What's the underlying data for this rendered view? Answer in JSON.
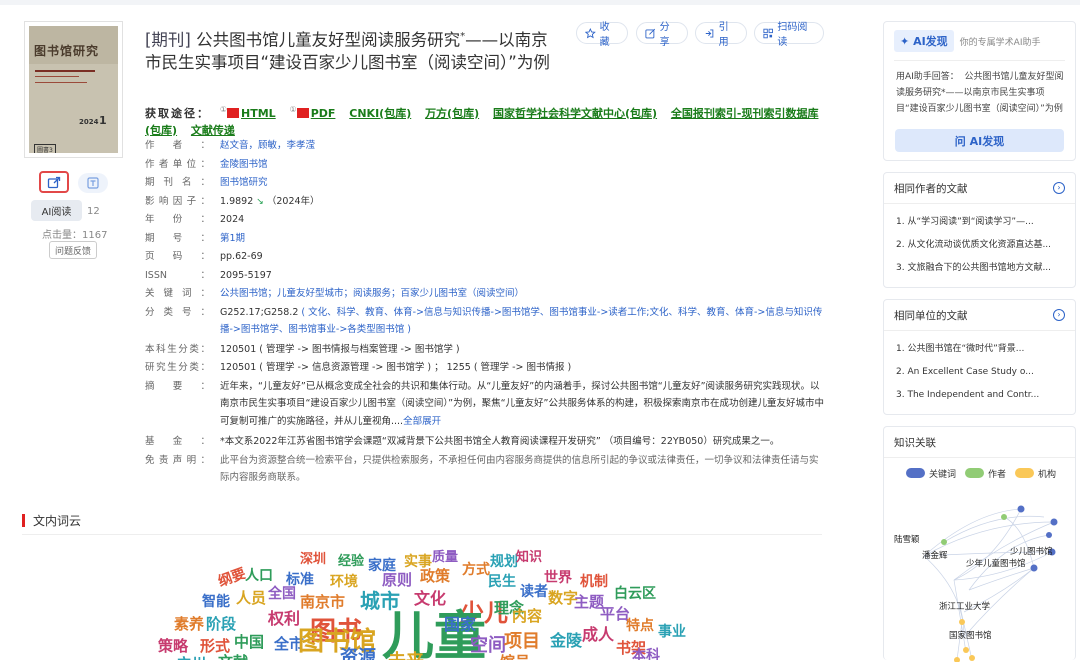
{
  "article": {
    "type_label": "[期刊]",
    "title": "公共图书馆儿童友好型阅读服务研究",
    "title_mark": "*",
    "title_rest": "——以南京市民生实事项目“建设百家少儿图书室（阅读空间）”为例"
  },
  "cover": {
    "journal_name": "图书馆研究",
    "year": "2024",
    "issue": "1",
    "code": "圖書3"
  },
  "actions": {
    "favorite": "收藏",
    "share": "分享",
    "cite": "引用",
    "scan": "扫码阅读"
  },
  "left_tools": {
    "ai_read": "AI阅读",
    "ai_count": "12",
    "clicks": "点击量：1167",
    "feedback": "问题反馈"
  },
  "access": {
    "label": "获取途径：",
    "links": [
      {
        "label": "HTML",
        "mark": "①",
        "pdf": true
      },
      {
        "label": "PDF",
        "mark": "①",
        "pdf": true
      },
      {
        "label": "CNKI(包库)"
      },
      {
        "label": "万方(包库)"
      },
      {
        "label": "国家哲学社会科学文献中心(包库)"
      },
      {
        "label": "全国报刊索引-现刊索引数据库(包库)"
      },
      {
        "label": "文献传递"
      }
    ]
  },
  "meta": {
    "author_k": "作者：",
    "author_v": "赵文音，顾敏，李孝滢",
    "unit_k": "作者单位：",
    "unit_v": "金陵图书馆",
    "journal_k": "期刊名：",
    "journal_v": "图书馆研究",
    "impact_k": "影响因子：",
    "impact_v": "1.9892",
    "impact_year": "（2024年）",
    "year_k": "年份：",
    "year_v": "2024",
    "issue_k": "期号：",
    "issue_v": "第1期",
    "pages_k": "页码：",
    "pages_v": "pp.62-69",
    "issn_k": "ISSN：",
    "issn_v": "2095-5197",
    "keywords_k": "关键词：",
    "keywords_v": "公共图书馆；儿童友好型城市；阅读服务；百家少儿图书室（阅读空间）",
    "class_k": "分类号：",
    "class_code": "G252.17;G258.2",
    "class_v": "( 文化、科学、教育、体育->信息与知识传播->图书馆学、图书馆事业->读者工作;文化、科学、教育、体育->信息与知识传播->图书馆学、图书馆事业->各类型图书馆 )",
    "undergrad_k": "本科生分类：",
    "undergrad_v": "120501 ( 管理学 -> 图书情报与档案管理 -> 图书馆学 )",
    "grad_k": "研究生分类：",
    "grad_v": "120501 ( 管理学 -> 信息资源管理 -> 图书馆学 ) ； 1255 ( 管理学 -> 图书情报 )",
    "abstract_k": "摘要：",
    "abstract_v": "近年来，“儿童友好”已从概念变成全社会的共识和集体行动。从“儿童友好”的内涵着手，探讨公共图书馆“儿童友好”阅读服务研究实践现状。以南京市民生实事项目“建设百家少儿图书室（阅读空间）”为例，聚焦“儿童友好”公共服务体系的构建，积极探索南京市在成功创建儿童友好城市中可复制可推广的实施路径，并从儿童视角....",
    "abstract_more": "全部展开",
    "fund_k": "基金：",
    "fund_v": "*本文系2022年江苏省图书馆学会课题“双减背景下公共图书馆全人教育阅读课程开发研究” （项目编号：22YB050）研究成果之一。",
    "disclaimer_k": "免责声明：",
    "disclaimer_v": "此平台为资源整合统一检索平台，只提供检索服务，不承担任何由内容服务商提供的信息所引起的争议或法律责任，一切争议和法律责任请与实际内容服务商联系。"
  },
  "cloud": {
    "heading": "文内词云",
    "words": [
      "深圳",
      "经验",
      "家庭",
      "实事",
      "质量",
      "方式",
      "规划",
      "知识",
      "纲要",
      "人口",
      "标准",
      "环境",
      "原则",
      "政策",
      "民生",
      "世界",
      "机制",
      "白云区",
      "智能",
      "人员",
      "全国",
      "南京市",
      "城市",
      "文化",
      "少儿",
      "理念",
      "读者",
      "数字",
      "主题",
      "素养",
      "阶段",
      "权利",
      "图书",
      "儿童",
      "国家",
      "内容",
      "平台",
      "特点",
      "事业",
      "策略",
      "形式",
      "中国",
      "全市",
      "图书馆",
      "空间",
      "项目",
      "金陵",
      "成人",
      "书架",
      "文献",
      "资源",
      "未来",
      "本科",
      "馆员",
      "广州"
    ]
  },
  "ai_panel": {
    "badge": "AI发现",
    "subtitle": "你的专属学术AI助手",
    "text": "用AI助手回答：  公共图书馆儿童友好型阅读服务研究*——以南京市民生实事项目“建设百家少儿图书室（阅读空间）”为例",
    "button": "问 AI发现"
  },
  "same_author": {
    "title": "相同作者的文献",
    "items": [
      "1. 从“学习阅读”到“阅读学习”—...",
      "2. 从文化流动谈优质文化资源直达基...",
      "3. 文旅融合下的公共图书馆地方文献..."
    ]
  },
  "same_unit": {
    "title": "相同单位的文献",
    "items": [
      "1. 公共图书馆在“微时代”背景...",
      "2. An Excellent Case Study o...",
      "3. The Independent and Contr..."
    ]
  },
  "knowledge": {
    "title": "知识关联",
    "legend": [
      {
        "label": "关键词",
        "color": "#5470c6"
      },
      {
        "label": "作者",
        "color": "#91cc75"
      },
      {
        "label": "机构",
        "color": "#fac858"
      }
    ],
    "nodes": [
      "陆雪颖",
      "潘金辉",
      "少儿图书馆",
      "少年儿童图书馆",
      "浙江工业大学",
      "国家图书馆"
    ]
  }
}
